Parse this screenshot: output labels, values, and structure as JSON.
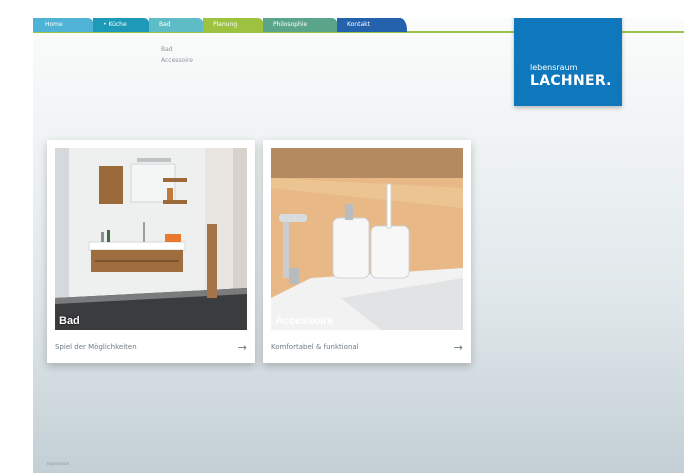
{
  "nav": {
    "tabs": [
      "Home",
      "• Küche",
      "Bad",
      "Planung",
      "Philosophie",
      "Kontakt"
    ]
  },
  "subnav": {
    "items": [
      "Bad",
      "Accessoire"
    ]
  },
  "logo": {
    "line1": "lebensraum",
    "line2": "LACHNER."
  },
  "cards": [
    {
      "tag": "Bad",
      "caption": "Spiel der Möglichkeiten",
      "arrow": "→"
    },
    {
      "tag": "Accessoire",
      "caption": "Komfortabel & funktional",
      "arrow": "→"
    }
  ],
  "footer": {
    "label": "Impressum"
  },
  "colors": {
    "tab_home": "#4fb3d6",
    "tab_kueche": "#1c9ab7",
    "tab_bad": "#5ebcc7",
    "tab_planung": "#9cc240",
    "tab_philosophie": "#5aa58a",
    "tab_kontakt": "#2562ae",
    "logo_bg": "#0f78bd",
    "accent_line": "#9dc24a"
  }
}
